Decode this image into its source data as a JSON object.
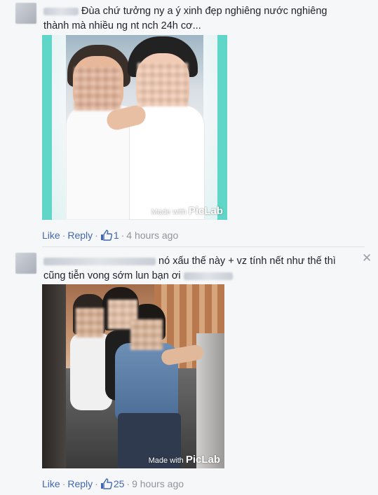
{
  "comments": [
    {
      "text_line1": "Đùa chứ tưởng ny a ý xinh đẹp nghiêng nước nghiêng",
      "text_line2": "thành mà nhiều ng nt nch 24h cơ...",
      "photo_watermark_prefix": "Made with",
      "photo_watermark_brand": "PicLab",
      "like_label": "Like",
      "reply_label": "Reply",
      "like_count": "1",
      "timestamp": "4 hours ago"
    },
    {
      "text_line1": "nó xấu thế này + vz tính nết như thế thì",
      "text_line2": "cũng tiễn vong sớm lun bạn ơi",
      "photo_watermark_prefix": "Made with",
      "photo_watermark_brand": "PicLab",
      "like_label": "Like",
      "reply_label": "Reply",
      "like_count": "25",
      "timestamp": "9 hours ago",
      "close_glyph": "✕"
    }
  ],
  "colors": {
    "link": "#4267b2",
    "meta": "#90949c",
    "teal_frame": "#5fd6c8"
  }
}
